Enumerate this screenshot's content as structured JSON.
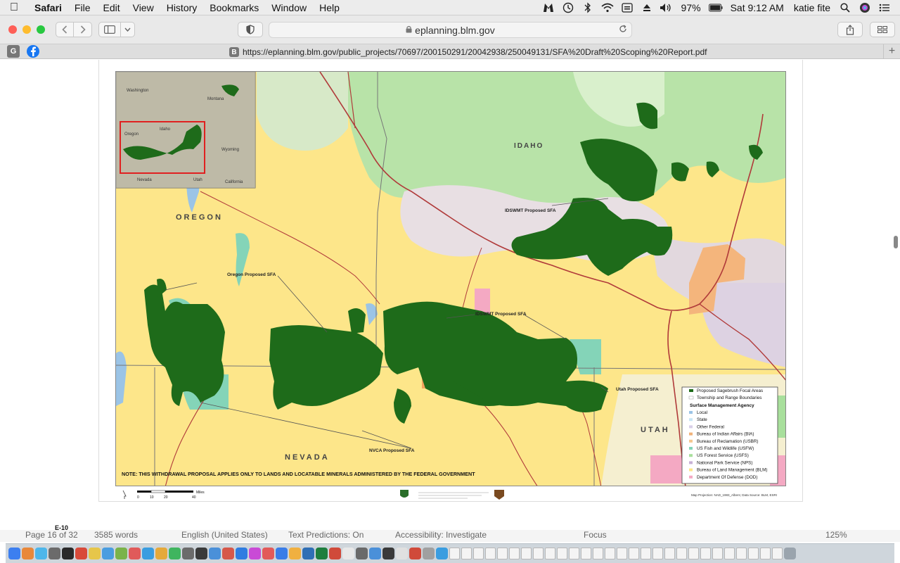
{
  "menubar": {
    "app_name": "Safari",
    "menus": [
      "File",
      "Edit",
      "View",
      "History",
      "Bookmarks",
      "Window",
      "Help"
    ],
    "battery": "97%",
    "clock": "Sat 9:12 AM",
    "user": "katie fite"
  },
  "toolbar": {
    "address_domain": "eplanning.blm.gov"
  },
  "favbar": {
    "fav1": "G",
    "tab_badge": "B",
    "tab_url": "https://eplanning.blm.gov/public_projects/70697/200150291/20042938/250049131/SFA%20Draft%20Scoping%20Report.pdf"
  },
  "map": {
    "state_labels": [
      "IDAHO",
      "OREGON",
      "NEVADA",
      "UTAH"
    ],
    "sfa_labels": [
      "IDSWMT Proposed SFA",
      "Oregon Proposed SFA",
      "IDSWMT Proposed SFA",
      "Utah Proposed SFA",
      "NVCA Proposed SFA"
    ],
    "inset_labels": [
      "Washington",
      "Montana",
      "Idaho",
      "Oregon",
      "Wyoming",
      "Nevada",
      "Utah",
      "California"
    ],
    "note": "NOTE:  THIS WITHDRAWAL PROPOSAL APPLIES ONLY TO LANDS AND LOCATABLE MINERALS ADMINISTERED BY THE FEDERAL GOVERNMENT",
    "scale_unit": "Miles",
    "scale_ticks": [
      "0",
      "10",
      "20",
      "40"
    ],
    "projection": "Map Projection: NAD_1983_Albers; Data Source: BLM, ESRI",
    "legend": {
      "items_top": [
        "Proposed Sagebrush Focal Areas",
        "Township and Range Boundaries"
      ],
      "heading": "Surface Management Agency",
      "agencies": [
        "Local",
        "State",
        "Other Federal",
        "Bureau of Indian Affairs (BIA)",
        "Bureau of Reclamation (USBR)",
        "US Fish and Wildlife (USFW)",
        "US Forest Service (USFS)",
        "National Park Service (NPS)",
        "Bureau of Land Management (BLM)",
        "Department Of Defense (DOD)"
      ],
      "colors": [
        "#9bc4e6",
        "#c9e6f5",
        "#d8cfe8",
        "#f0b27a",
        "#f4c78f",
        "#84d4b8",
        "#a8df9c",
        "#c7b0d6",
        "#fde68a",
        "#f4a9c3"
      ]
    }
  },
  "page": {
    "label": "E-10"
  },
  "wordstatus": {
    "page": "Page 16 of 32",
    "words": "3585 words",
    "language": "English (United States)",
    "predictions": "Text Predictions: On",
    "accessibility": "Accessibility: Investigate",
    "focus": "Focus",
    "zoom": "125%"
  },
  "dock": {
    "icon_colors": [
      "#3c7ff0",
      "#e8883a",
      "#4db6ea",
      "#6b6b6b",
      "#2a2a2a",
      "#d84a3a",
      "#e6c64a",
      "#4a9de0",
      "#7ab34a",
      "#e05a5a",
      "#3a9de0",
      "#e5a93a",
      "#3fb55f",
      "#6b6b6b",
      "#3a3a3a",
      "#4a90d9",
      "#d6584a",
      "#2f7de1",
      "#c94ad6",
      "#e25a5a",
      "#3a7de8",
      "#f0b040",
      "#2f6fb5",
      "#1e7e3e",
      "#d04a3a",
      "#e8e8e8",
      "#6a6a6a",
      "#4a90d9",
      "#3a3a3a",
      "#e0e0e0",
      "#d04a3a",
      "#a0a0a0",
      "#3a9de0",
      "#f4f4f4",
      "#f4f4f4",
      "#f4f4f4",
      "#f4f4f4",
      "#f4f4f4",
      "#f4f4f4",
      "#f4f4f4",
      "#f4f4f4",
      "#f4f4f4",
      "#f4f4f4",
      "#f4f4f4",
      "#f4f4f4",
      "#f4f4f4",
      "#f4f4f4",
      "#f4f4f4",
      "#f4f4f4",
      "#f4f4f4",
      "#f4f4f4",
      "#f4f4f4",
      "#f4f4f4",
      "#f4f4f4",
      "#f4f4f4",
      "#f4f4f4",
      "#f4f4f4",
      "#f4f4f4",
      "#f4f4f4",
      "#f4f4f4",
      "#f4f4f4",
      "#9aa4ad"
    ]
  }
}
